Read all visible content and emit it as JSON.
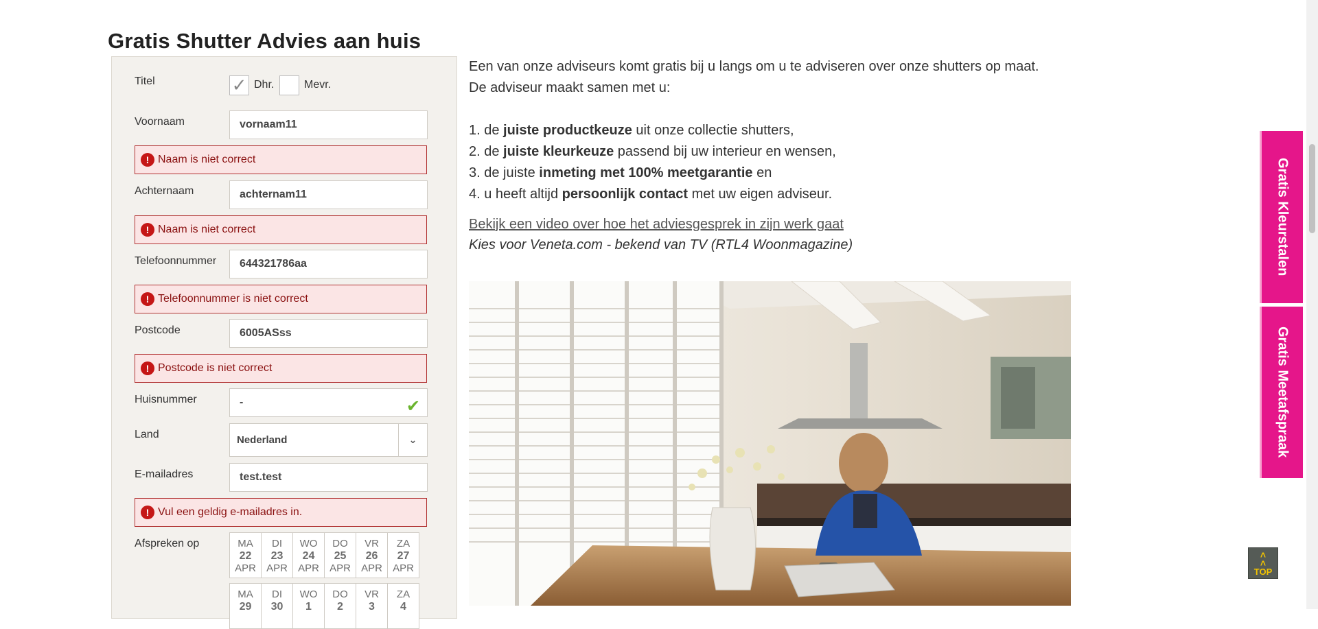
{
  "page": {
    "title": "Gratis Shutter Advies aan huis"
  },
  "form": {
    "titel": {
      "label": "Titel",
      "options": [
        {
          "label": "Dhr.",
          "checked": true
        },
        {
          "label": "Mevr.",
          "checked": false
        }
      ]
    },
    "voornaam": {
      "label": "Voornaam",
      "value": "vornaam11",
      "error": "Naam is niet correct"
    },
    "achternaam": {
      "label": "Achternaam",
      "value": "achternam11",
      "error": "Naam is niet correct"
    },
    "telefoon": {
      "label": "Telefoonnummer",
      "value": "644321786aa",
      "error": "Telefoonnummer is niet correct"
    },
    "postcode": {
      "label": "Postcode",
      "value": "6005ASss",
      "error": "Postcode is niet correct"
    },
    "huisnummer": {
      "label": "Huisnummer",
      "value": "-",
      "valid_icon": "checkmark-icon"
    },
    "land": {
      "label": "Land",
      "value": "Nederland",
      "arrow_icon": "chevron-down-icon"
    },
    "email": {
      "label": "E-mailadres",
      "value": "test.test",
      "error": "Vul een geldig e-mailadres in."
    },
    "afspreken": {
      "label": "Afspreken op",
      "week1": [
        {
          "day": "MA",
          "num": "22",
          "month": "APR"
        },
        {
          "day": "DI",
          "num": "23",
          "month": "APR"
        },
        {
          "day": "WO",
          "num": "24",
          "month": "APR"
        },
        {
          "day": "DO",
          "num": "25",
          "month": "APR"
        },
        {
          "day": "VR",
          "num": "26",
          "month": "APR"
        },
        {
          "day": "ZA",
          "num": "27",
          "month": "APR"
        }
      ],
      "week2": [
        {
          "day": "MA",
          "num": "29"
        },
        {
          "day": "DI",
          "num": "30"
        },
        {
          "day": "WO",
          "num": "1"
        },
        {
          "day": "DO",
          "num": "2"
        },
        {
          "day": "VR",
          "num": "3"
        },
        {
          "day": "ZA",
          "num": "4"
        }
      ]
    },
    "error_icon": "exclamation-icon"
  },
  "content": {
    "intro_line1": "Een van onze adviseurs komt gratis bij u langs om u te adviseren over onze shutters op maat.",
    "intro_line2": "De adviseur maakt samen met u:",
    "list": [
      {
        "prefix": "1. de ",
        "bold": "juiste productkeuze",
        "suffix": " uit onze collectie shutters,"
      },
      {
        "prefix": "2. de ",
        "bold": "juiste kleurkeuze",
        "suffix": " passend bij uw interieur en wensen,"
      },
      {
        "prefix": "3. de juiste ",
        "bold": "inmeting met 100% meetgarantie",
        "suffix": " en"
      },
      {
        "prefix": "4. u heeft altijd ",
        "bold": "persoonlijk contact",
        "suffix": " met uw eigen adviseur."
      }
    ],
    "video_link": "Bekijk een video over hoe het adviesgesprek in zijn werk gaat",
    "tv_line": "Kies voor Veneta.com - bekend van TV (RTL4 Woonmagazine)"
  },
  "side_tabs": {
    "kleurstalen": "Gratis Kleurstalen",
    "meetafspraak": "Gratis Meetafspraak"
  },
  "top_button": {
    "icon": "double-chevron-up-icon",
    "label": "TOP"
  },
  "colors": {
    "accent_pink": "#e5168a",
    "error_red": "#c51616",
    "valid_green": "#6ab42d",
    "panel_bg": "#f3f1ed"
  }
}
